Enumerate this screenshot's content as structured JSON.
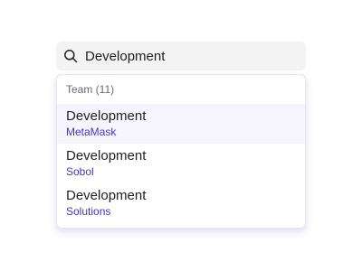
{
  "search": {
    "value": "Development",
    "icon": "search-icon"
  },
  "dropdown": {
    "group_label": "Team (11)",
    "results": [
      {
        "title": "Development",
        "subtitle": "MetaMask",
        "highlighted": true
      },
      {
        "title": "Development",
        "subtitle": "Sobol",
        "highlighted": false
      },
      {
        "title": "Development",
        "subtitle": "Solutions",
        "highlighted": false
      }
    ]
  },
  "colors": {
    "accent": "#4b32c3",
    "search_bg": "#f3f3f4",
    "highlight_bg": "#f6f5fd",
    "text": "#1f1f24",
    "muted": "#6b6b75"
  }
}
